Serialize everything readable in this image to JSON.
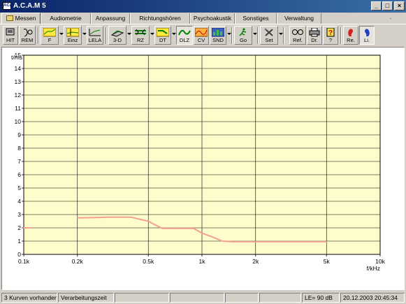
{
  "window": {
    "title": "A.C.A.M 5",
    "app_icon_text": "ACAM"
  },
  "tabs": [
    "Messen",
    "Audiometrie",
    "Anpassung",
    "Richtungshören",
    "Psychoakustik",
    "Sonstiges",
    "Verwaltung"
  ],
  "tab_extra": "·",
  "toolbar": {
    "hit": "HIT",
    "rem": "REM",
    "f": "F",
    "einz": "Einz",
    "lela": "LELA",
    "d3": "3-D",
    "rz": "RZ",
    "dt": "DT",
    "dlz": "DLZ",
    "cv": "CV",
    "snd": "SND",
    "go": "Go",
    "set": "Set",
    "ref": "Ref.",
    "dr": "Dr.",
    "help": "?",
    "re": "Re.",
    "li": "Li."
  },
  "colors": {
    "plot_bg": "#fdfccb",
    "curve": "#f4a090",
    "titlebar": "#0a246a"
  },
  "chart_data": {
    "type": "line",
    "ylabel": "t/ms",
    "xlabel": "f/kHz",
    "xscale": "log",
    "xlim": [
      0.1,
      10
    ],
    "ylim": [
      0,
      15
    ],
    "yticks": [
      0,
      1,
      2,
      3,
      4,
      5,
      6,
      7,
      8,
      9,
      10,
      11,
      12,
      13,
      14,
      15
    ],
    "xgrid": [
      0.1,
      0.2,
      0.5,
      1,
      2,
      5,
      10
    ],
    "xticklabels": [
      "0.1k",
      "0.2k",
      "0.5k",
      "1k",
      "2k",
      "5k",
      "10k"
    ],
    "grid": true,
    "series": [
      {
        "color": "#f4a090",
        "x": [
          0.1,
          0.11
        ],
        "y": [
          2.0,
          2.0
        ]
      },
      {
        "color": "#f4a090",
        "x": [
          0.2,
          0.3,
          0.4,
          0.5,
          0.55,
          0.6,
          0.7,
          0.9,
          1.0,
          1.15,
          1.3,
          1.5,
          2.0,
          3.0,
          5.0
        ],
        "y": [
          2.75,
          2.8,
          2.8,
          2.5,
          2.2,
          1.95,
          1.95,
          1.95,
          1.6,
          1.3,
          1.0,
          0.95,
          0.95,
          0.95,
          0.95
        ]
      }
    ]
  },
  "status": {
    "curves": "3 Kurven vorhanden",
    "processing": "Verarbeitungszeit",
    "le": "LE= 90 dB",
    "datetime": "20.12.2003 20:45:34"
  }
}
